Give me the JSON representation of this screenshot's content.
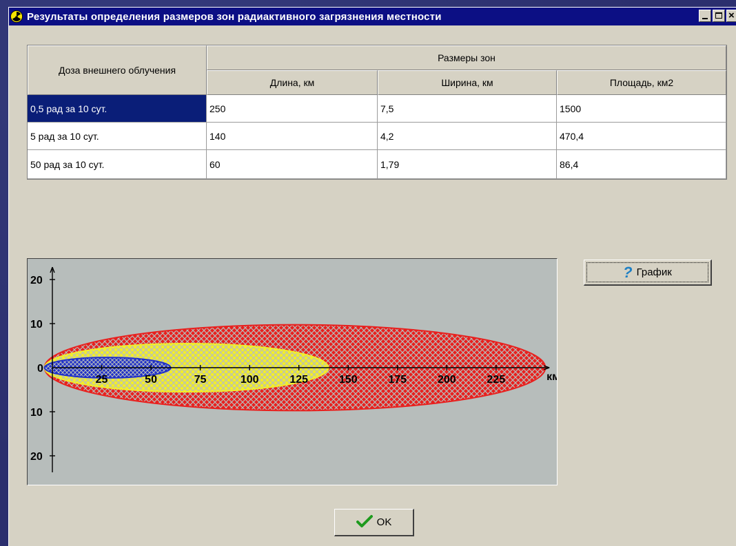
{
  "window": {
    "title": "Результаты определения размеров зон радиактивного загрязнения местности"
  },
  "table": {
    "header_dose": "Доза внешнего облучения",
    "header_group": "Размеры зон",
    "columns": [
      "Длина, км",
      "Ширина, км",
      "Площадь, км2"
    ],
    "rows": [
      {
        "dose": "0,5  рад за 10 сут.",
        "length": "250",
        "width": "7,5",
        "area": "1500"
      },
      {
        "dose": "5  рад за 10 сут.",
        "length": "140",
        "width": "4,2",
        "area": "470,4"
      },
      {
        "dose": "50  рад за 10 сут.",
        "length": "60",
        "width": "1,79",
        "area": "86,4"
      }
    ]
  },
  "buttons": {
    "graph_label": "График",
    "graph_icon": "help-question-icon",
    "ok_label": "OK",
    "ok_icon": "checkmark-icon"
  },
  "colors": {
    "titlebar": "#0c0f84",
    "selected_row": "#0a1e78",
    "zone_red": "#e8201e",
    "zone_yellow": "#f2ee2a",
    "zone_blue": "#2030c8",
    "chart_bg": "#b7bdbb"
  },
  "chart_data": {
    "type": "area",
    "x_unit": "км",
    "x_ticks": [
      "25",
      "50",
      "75",
      "100",
      "125",
      "150",
      "175",
      "200",
      "225"
    ],
    "y_ticks_upper": [
      "20",
      "10"
    ],
    "y_tick_zero": "0",
    "y_ticks_lower": [
      "10",
      "20"
    ],
    "xlim": [
      0,
      250
    ],
    "ylim": [
      -25,
      25
    ],
    "zones": [
      {
        "length_km": 250,
        "width_km": 7.5,
        "color": "#e8201e"
      },
      {
        "length_km": 140,
        "width_km": 4.2,
        "color": "#f2ee2a"
      },
      {
        "length_km": 60,
        "width_km": 1.79,
        "color": "#2030c8"
      }
    ]
  }
}
